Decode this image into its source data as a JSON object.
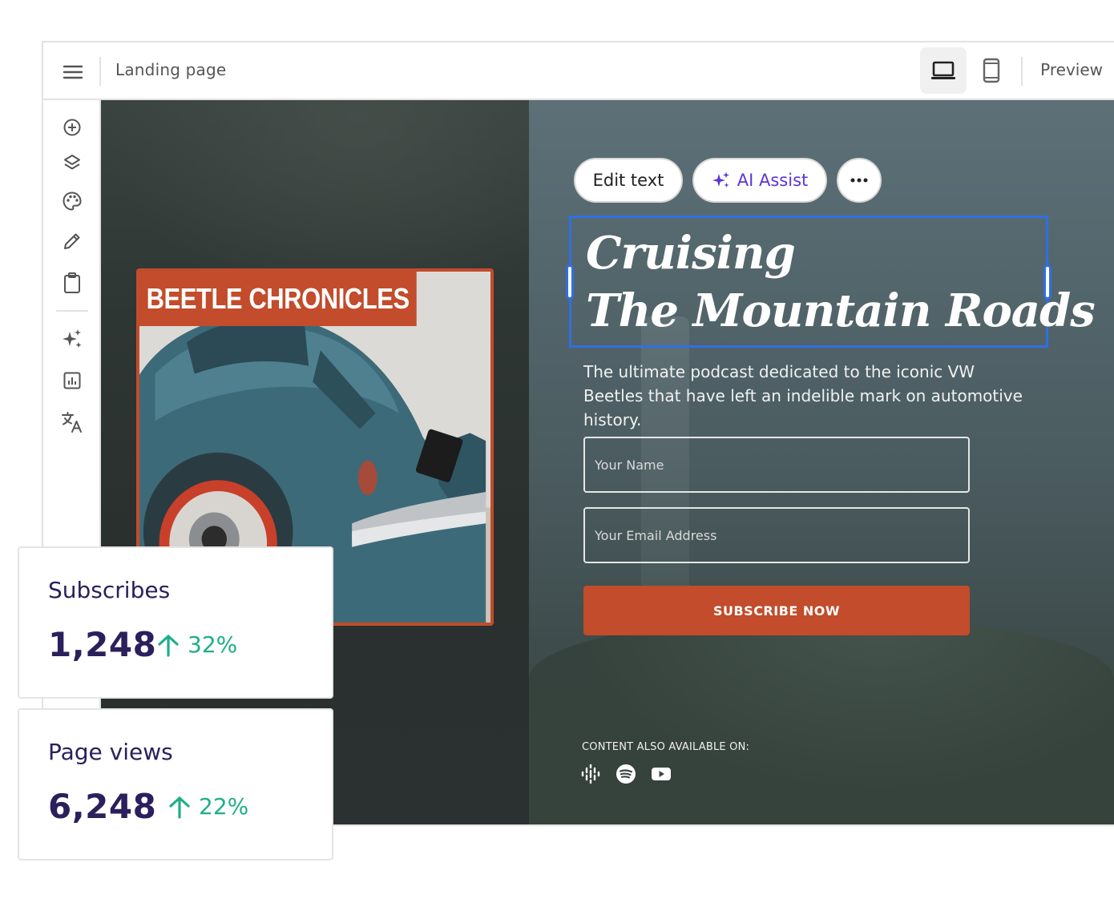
{
  "topbar": {
    "page_name": "Landing page",
    "preview_label": "Preview"
  },
  "sidebar": {
    "icons": [
      "add-icon",
      "layers-icon",
      "palette-icon",
      "pencil-icon",
      "clipboard-icon",
      "sparkles-icon",
      "analytics-icon",
      "translate-icon"
    ]
  },
  "toolbar": {
    "edit_text_label": "Edit text",
    "ai_assist_label": "AI Assist"
  },
  "hero": {
    "book_label": "BEETLE CHRONICLES",
    "headline_line1": "Cruising",
    "headline_line2": "The Mountain Roads",
    "description": "The ultimate podcast dedicated to the iconic VW Beetles that have left an indelible mark on automotive history.",
    "name_placeholder": "Your Name",
    "email_placeholder": "Your Email Address",
    "cta_label": "SUBSCRIBE NOW",
    "available_label": "CONTENT ALSO AVAILABLE ON:",
    "platforms": [
      "google-podcasts-icon",
      "spotify-icon",
      "youtube-icon"
    ]
  },
  "stats": [
    {
      "title": "Subscribes",
      "value": "1,248",
      "change": "32%"
    },
    {
      "title": "Page views",
      "value": "6,248",
      "change": "22%"
    }
  ],
  "colors": {
    "accent": "#c24c2b",
    "selection": "#2f6fe4",
    "ai": "#5b36d6",
    "positive": "#1fae88",
    "stat_text": "#2b1f5c"
  }
}
